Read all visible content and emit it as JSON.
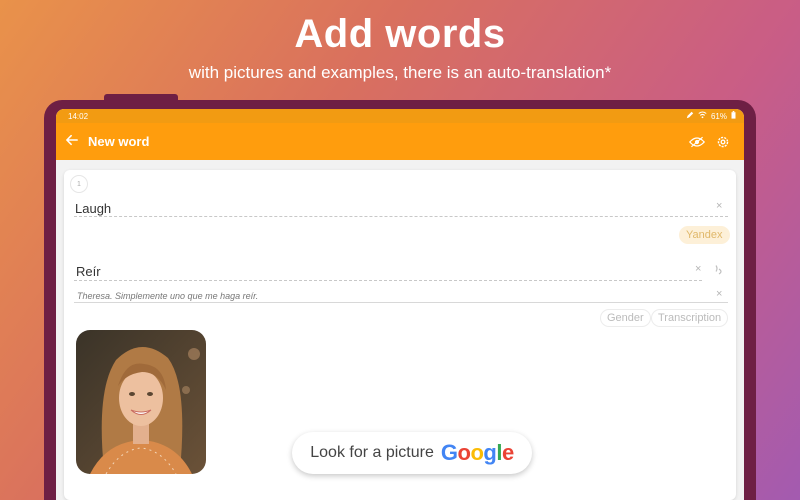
{
  "promo": {
    "headline": "Add words",
    "subheadline": "with pictures and examples, there is an auto-translation*"
  },
  "status_bar": {
    "time": "14:02",
    "battery": "61%"
  },
  "app_bar": {
    "back_icon": "arrow-left-icon",
    "title": "New word",
    "actions": [
      "eye-icon",
      "settings-icon"
    ]
  },
  "word_card": {
    "number": "1",
    "word": "Laugh",
    "translation_provider": "Yandex",
    "translation": "Reír",
    "example": "Theresa. Simplemente uno que me haga reír.",
    "chips": [
      "Gender",
      "Transcription"
    ],
    "image_alt": "portrait photo of smiling woman",
    "picture_button": {
      "label": "Look for a picture",
      "brand": [
        "G",
        "o",
        "o",
        "g",
        "l",
        "e"
      ],
      "brand_colors": [
        "#4285F4",
        "#EA4335",
        "#FBBC05",
        "#4285F4",
        "#34A853",
        "#EA4335"
      ]
    }
  },
  "colors": {
    "accent": "#ff9d0d",
    "status_bar": "#f29b12",
    "device_frame": "#6e1f44"
  }
}
